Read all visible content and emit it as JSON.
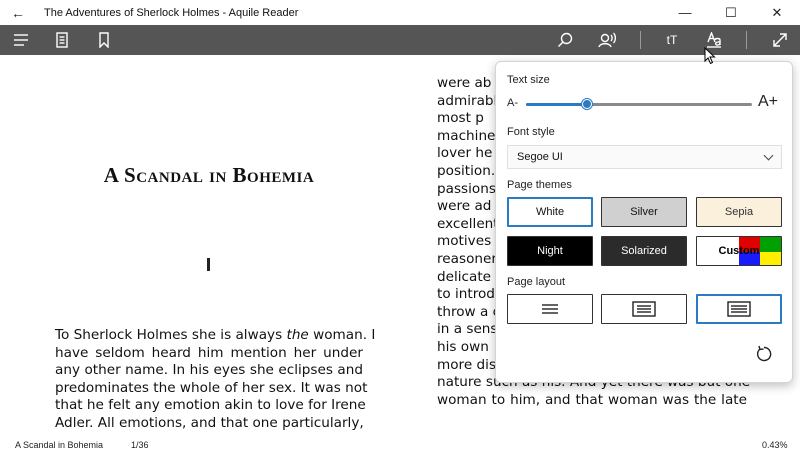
{
  "window": {
    "back_glyph": "←",
    "title": "The Adventures of Sherlock Holmes - Aquile Reader",
    "minimize_glyph": "—",
    "maximize_glyph": "☐",
    "close_glyph": "✕"
  },
  "toolbar": {
    "left_icons": [
      "menu-icon",
      "notes-icon",
      "bookmark-icon"
    ],
    "right_icons": [
      "search-icon",
      "read-aloud-icon",
      "text-size-icon",
      "font-style-icon",
      "fullscreen-icon"
    ],
    "text_size_glyph": "tT",
    "background": "#555555"
  },
  "book": {
    "chapter_title": "A Scandal in Bohemia",
    "left_lines": [
      "To Sherlock Holmes she is always the woman. I",
      "have seldom heard him mention her under",
      "any other name. In his eyes she eclipses and",
      "predominates the whole of her sex. It was not",
      "that he felt any emotion akin to love for Irene",
      "Adler. All emotions, and that one particularly,"
    ],
    "right_lines": [
      "were ab",
      "admirabl",
      "most p",
      "machine",
      "lover he",
      "position.",
      "passions,",
      "were ad",
      "excellent",
      "motives",
      "reasoner",
      "delicate a",
      "to introd",
      "throw a c",
      "in a sens",
      "his own",
      "more dis",
      "nature such as his. And yet there was but one",
      "woman to him, and that woman was the late"
    ]
  },
  "status": {
    "chapter": "A Scandal in Bohemia",
    "page": "1/36",
    "progress": "0.43%"
  },
  "settings": {
    "text_size_label": "Text size",
    "size_min_label": "A-",
    "size_max_label": "A+",
    "text_size_value": 0.27,
    "font_style_label": "Font style",
    "font_style_value": "Segoe UI",
    "page_themes_label": "Page themes",
    "themes": [
      {
        "label": "White",
        "bg": "#ffffff",
        "fg": "#111111",
        "selected": true
      },
      {
        "label": "Silver",
        "bg": "#d0d0d0",
        "fg": "#111111",
        "selected": false
      },
      {
        "label": "Sepia",
        "bg": "#faf0dc",
        "fg": "#333333",
        "selected": false
      },
      {
        "label": "Night",
        "bg": "#000000",
        "fg": "#ffffff",
        "selected": false
      },
      {
        "label": "Solarized",
        "bg": "#2b2b2b",
        "fg": "#ffffff",
        "selected": false
      },
      {
        "label": "Custom",
        "bg": "#ffffff",
        "fg": "#000000",
        "selected": false
      }
    ],
    "custom_swatch_colors": [
      "#e00000",
      "#00a000",
      "#1a1aff",
      "#ffee00"
    ],
    "page_layout_label": "Page layout",
    "layouts": [
      "single-column",
      "two-column-narrow",
      "two-column-wide"
    ],
    "selected_layout": "two-column-wide",
    "accent": "#2b7bc4"
  }
}
